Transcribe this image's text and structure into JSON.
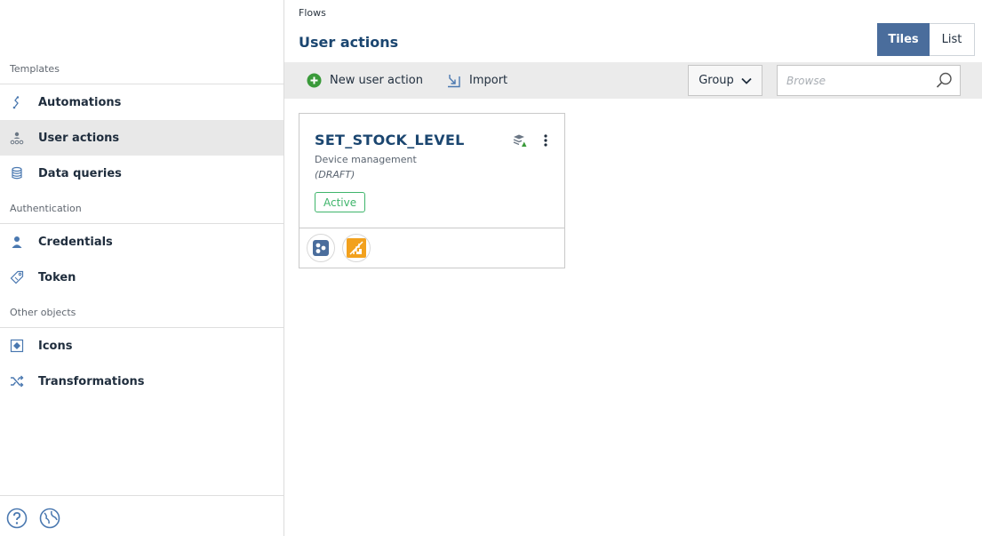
{
  "sidebar": {
    "sections": [
      {
        "title": "Templates"
      },
      {
        "title": "Authentication"
      },
      {
        "title": "Other objects"
      }
    ],
    "items": [
      {
        "label": "Automations",
        "icon": "automations-icon"
      },
      {
        "label": "User actions",
        "icon": "user-actions-icon",
        "active": true
      },
      {
        "label": "Data queries",
        "icon": "database-icon"
      },
      {
        "label": "Credentials",
        "icon": "person-icon"
      },
      {
        "label": "Token",
        "icon": "tag-icon"
      },
      {
        "label": "Icons",
        "icon": "icons-icon"
      },
      {
        "label": "Transformations",
        "icon": "shuffle-icon"
      }
    ],
    "bottom_icons": [
      "help-icon",
      "globe-icon"
    ]
  },
  "header": {
    "breadcrumb": "Flows",
    "title": "User actions",
    "view_toggle": {
      "tiles": "Tiles",
      "list": "List",
      "selected": "Tiles"
    }
  },
  "toolbar": {
    "new_label": "New user action",
    "import_label": "Import",
    "group_label": "Group",
    "search_placeholder": "Browse"
  },
  "tiles": [
    {
      "title": "SET_STOCK_LEVEL",
      "subtitle": "Device management",
      "state": "(DRAFT)",
      "status": "Active",
      "footer_icons": [
        "app-icon-blue",
        "app-icon-orange"
      ]
    }
  ],
  "colors": {
    "accent": "#4a6d9c",
    "title": "#1b4670",
    "active_green": "#3fb56b",
    "add_green": "#3a9a3a",
    "icon_blue": "#4a78b0"
  }
}
